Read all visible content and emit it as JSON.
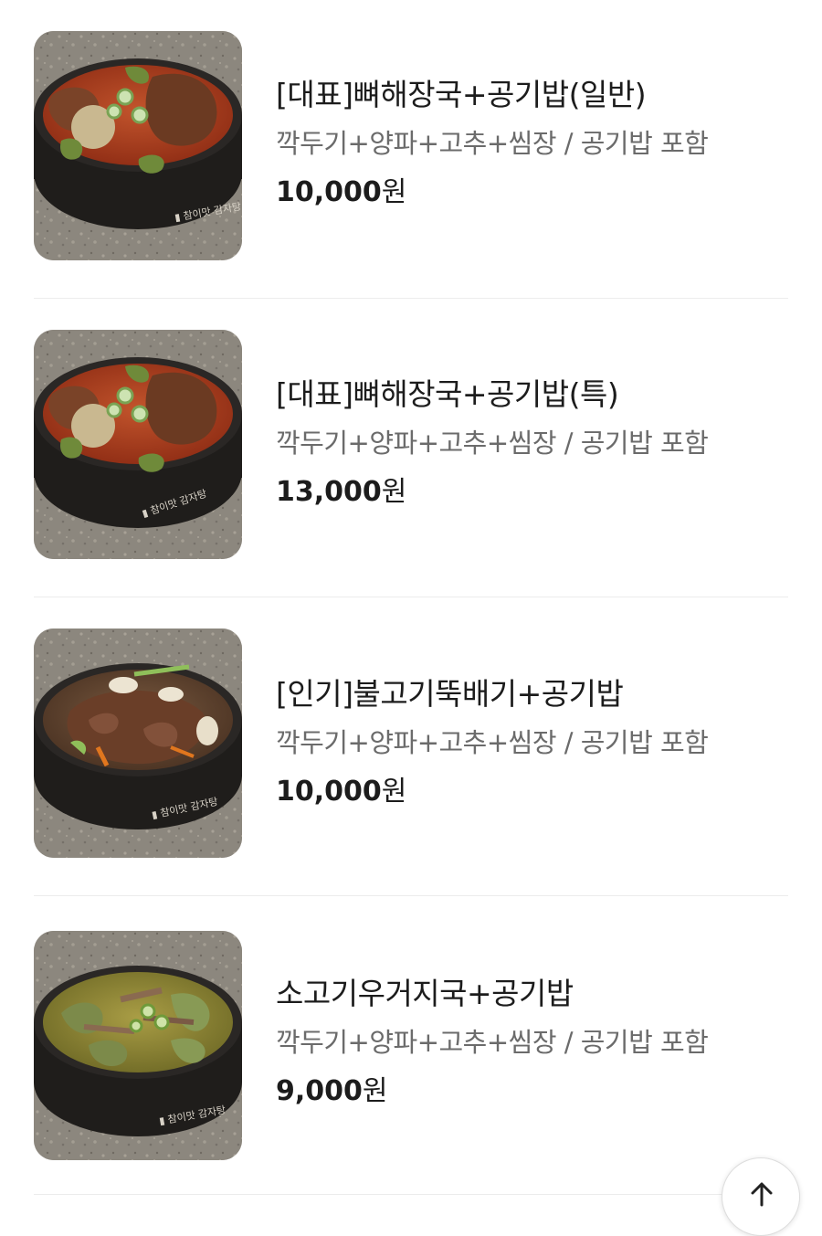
{
  "menu": {
    "items": [
      {
        "name": "[대표]뼈해장국+공기밥(일반)",
        "description": "깍두기+양파+고추+씸장 / 공기밥 포함",
        "price": "10,000",
        "currency": "원",
        "image_icon": "bone-hangover-soup-photo",
        "bowl_logo": "참이맛 감자탕"
      },
      {
        "name": "[대표]뼈해장국+공기밥(특)",
        "description": "깍두기+양파+고추+씸장 / 공기밥 포함",
        "price": "13,000",
        "currency": "원",
        "image_icon": "bone-hangover-soup-photo",
        "bowl_logo": "참이맛 감자탕"
      },
      {
        "name": "[인기]불고기뚝배기+공기밥",
        "description": "깍두기+양파+고추+씸장 / 공기밥 포함",
        "price": "10,000",
        "currency": "원",
        "image_icon": "bulgogi-hotpot-photo",
        "bowl_logo": "참이맛 감자탕"
      },
      {
        "name": "소고기우거지국+공기밥",
        "description": "깍두기+양파+고추+씸장 / 공기밥 포함",
        "price": "9,000",
        "currency": "원",
        "image_icon": "beef-cabbage-soup-photo",
        "bowl_logo": "참이맛 감자탕"
      }
    ]
  },
  "scroll_top": {
    "icon": "arrow-up-icon"
  },
  "colors": {
    "text_primary": "#1c1c1c",
    "text_secondary": "#6b6b6b",
    "divider": "#ececec"
  }
}
